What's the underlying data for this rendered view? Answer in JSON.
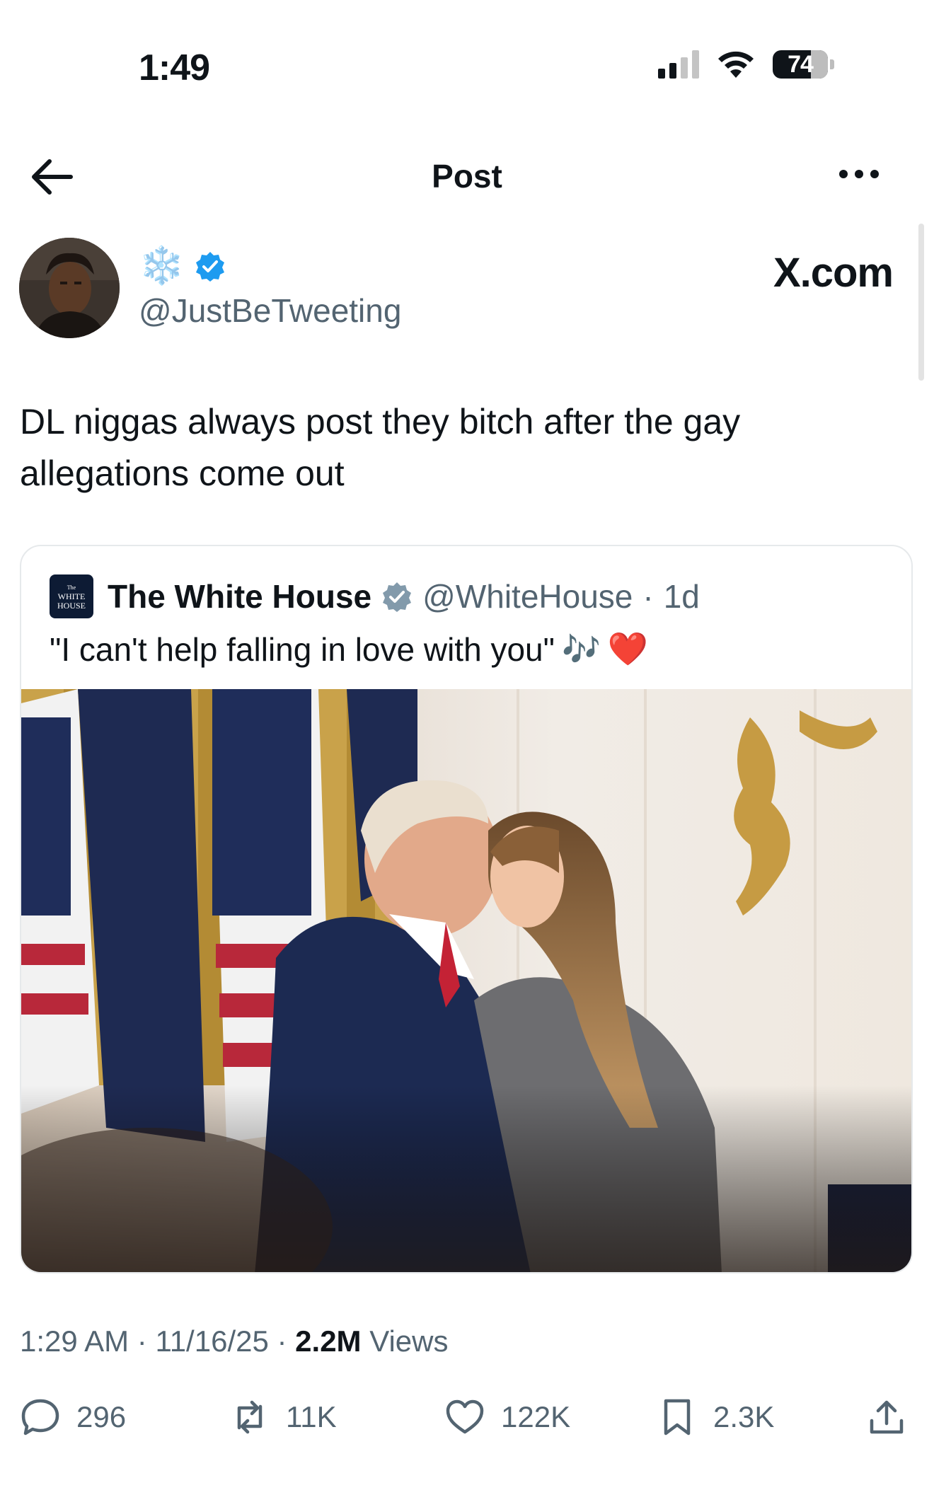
{
  "status_bar": {
    "time": "1:49",
    "battery": "74",
    "signal_icon": "cellular-signal-icon",
    "wifi_icon": "wifi-icon"
  },
  "nav": {
    "title": "Post",
    "back_icon": "arrow-left-icon",
    "more_icon": "more-horizontal-icon"
  },
  "author": {
    "display_name": "❄️",
    "verified": true,
    "handle": "@JustBeTweeting",
    "watermark": "X.com"
  },
  "tweet": {
    "text": "DL niggas always post they bitch after the gay allegations come out"
  },
  "quoted": {
    "logo_text": [
      "The",
      "WHITE",
      "HOUSE"
    ],
    "name": "The White House",
    "verified_color": "#829aab",
    "handle": "@WhiteHouse",
    "separator": "·",
    "age": "1d",
    "text": "\"I can't help falling in love with you\"",
    "emoji_notes": "🎶",
    "emoji_heart": "❤️"
  },
  "meta": {
    "time": "1:29 AM",
    "sep1": "·",
    "date": "11/16/25",
    "sep2": "·",
    "views_count": "2.2M",
    "views_label": "Views"
  },
  "actions": {
    "replies": "296",
    "reposts": "11K",
    "likes": "122K",
    "bookmarks": "2.3K"
  },
  "colors": {
    "text": "#0f1419",
    "secondary": "#536471",
    "verified_blue": "#1d9bf0",
    "border": "#e6e9eb"
  }
}
